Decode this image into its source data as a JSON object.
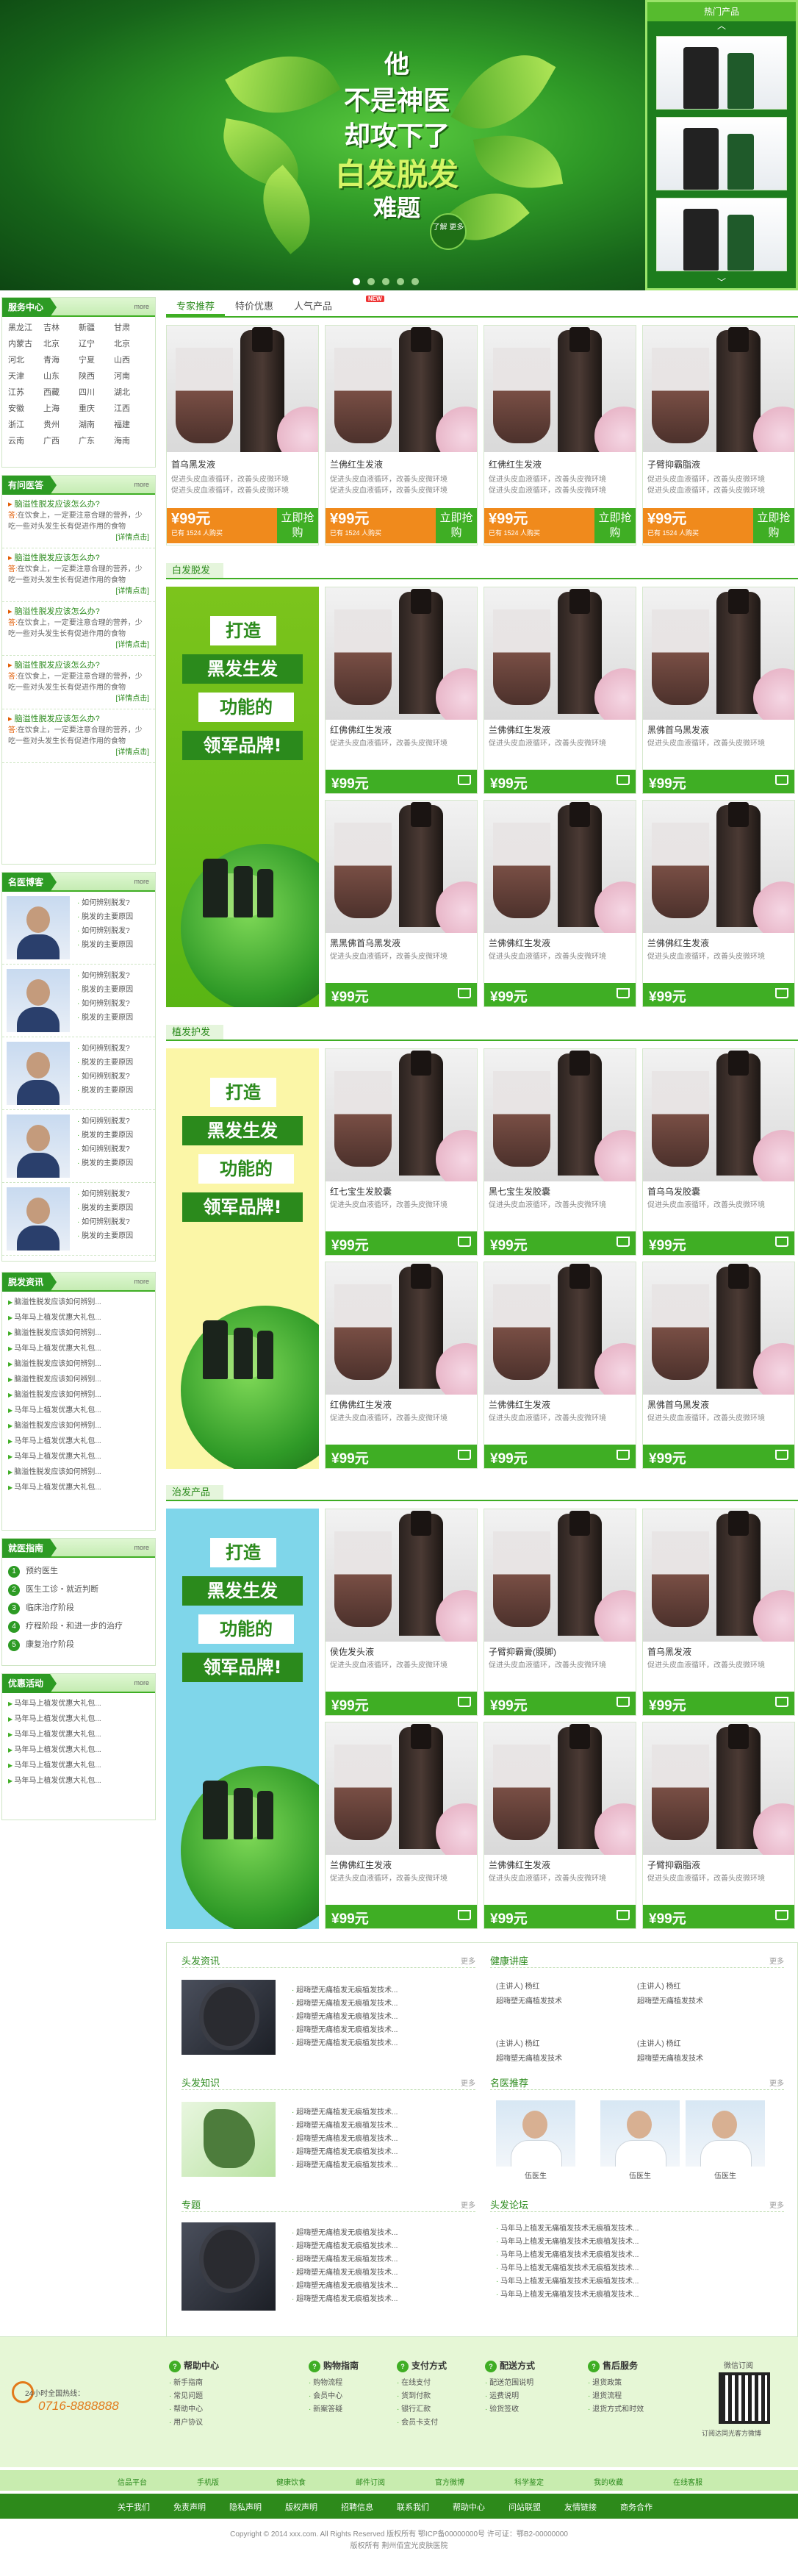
{
  "banner": {
    "l1": "他",
    "l2": "不是神医",
    "l3": "却攻下了",
    "l4": "白发脱发",
    "l5": "难题",
    "know": "了解\n更多",
    "hot_title": "热门产品"
  },
  "left": {
    "service": {
      "title": "服务中心",
      "more": "more",
      "regions": [
        "黑龙江",
        "吉林",
        "新疆",
        "甘肃",
        "内蒙古",
        "北京",
        "辽宁",
        "北京",
        "河北",
        "青海",
        "宁夏",
        "山西",
        "天津",
        "山东",
        "陕西",
        "河南",
        "江苏",
        "西藏",
        "四川",
        "湖北",
        "安徽",
        "上海",
        "重庆",
        "江西",
        "浙江",
        "贵州",
        "湖南",
        "福建",
        "云南",
        "广西",
        "广东",
        "海南"
      ]
    },
    "qa": {
      "title": "有问医答",
      "more": "more",
      "q": "脑溢性脱发应该怎么办?",
      "a_label": "答:",
      "a": "在饮食上，一定要注意合理的营养，少吃一些对头发生长有促进作用的食物",
      "detail": "[详情点击]"
    },
    "docs": {
      "title": "名医博客",
      "more": "more",
      "lines": [
        "如何辨别脱发?",
        "脱发的主要原因",
        "如何辨别脱发?",
        "脱发的主要原因"
      ]
    },
    "news": {
      "title": "脱发资讯",
      "more": "more",
      "items": [
        "脑溢性脱发应该如何辨别...",
        "马年马上植发优惠大礼包...",
        "脑溢性脱发应该如何辨别...",
        "马年马上植发优惠大礼包...",
        "脑溢性脱发应该如何辨别...",
        "脑溢性脱发应该如何辨别...",
        "脑溢性脱发应该如何辨别...",
        "马年马上植发优惠大礼包...",
        "脑溢性脱发应该如何辨别...",
        "马年马上植发优惠大礼包...",
        "马年马上植发优惠大礼包...",
        "脑溢性脱发应该如何辨别...",
        "马年马上植发优惠大礼包..."
      ]
    },
    "guide": {
      "title": "就医指南",
      "more": "more",
      "items": [
        "预约医生",
        "医生工诊・就近判断",
        "临床治疗阶段",
        "疗程阶段・和进一步的治疗",
        "康复治疗阶段"
      ]
    },
    "promo": {
      "title": "优惠活动",
      "more": "more",
      "items": [
        "马年马上植发优惠大礼包...",
        "马年马上植发优惠大礼包...",
        "马年马上植发优惠大礼包...",
        "马年马上植发优惠大礼包...",
        "马年马上植发优惠大礼包...",
        "马年马上植发优惠大礼包..."
      ]
    }
  },
  "tabs": [
    "专家推荐",
    "特价优惠",
    "人气产品"
  ],
  "tab_new": "NEW",
  "featured": [
    {
      "title": "首乌黑发液",
      "desc": "促进头皮血液循环，改善头皮微环境",
      "desc2": "促进头皮血液循环，改善头皮微环境",
      "price": "¥99元",
      "sold": "已有 1524 人购买",
      "go": "立即抢购"
    },
    {
      "title": "兰佛红生发液",
      "desc": "促进头皮血液循环，改善头皮微环境",
      "desc2": "促进头皮血液循环，改善头皮微环境",
      "price": "¥99元",
      "sold": "已有 1524 人购买",
      "go": "立即抢购"
    },
    {
      "title": "红佛红生发液",
      "desc": "促进头皮血液循环，改善头皮微环境",
      "desc2": "促进头皮血液循环，改善头皮微环境",
      "price": "¥99元",
      "sold": "已有 1524 人购买",
      "go": "立即抢购"
    },
    {
      "title": "子臂抑霸脂液",
      "desc": "促进头皮血液循环，改善头皮微环境",
      "desc2": "促进头皮血液循环，改善头皮微环境",
      "price": "¥99元",
      "sold": "已有 1524 人购买",
      "go": "立即抢购"
    }
  ],
  "promo_text": {
    "a": "打造",
    "b": "黑发生发",
    "c": "功能的",
    "d": "领军品牌!"
  },
  "sections": [
    {
      "title": "白发脱发",
      "items": [
        "红佛佛红生发液",
        "兰佛佛红生发液",
        "黑佛首乌黑发液",
        "黑黑佛首乌黑发液",
        "兰佛佛红生发液",
        "兰佛佛红生发液"
      ]
    },
    {
      "title": "植发护发",
      "items": [
        "红七宝生发胶囊",
        "黑七宝生发胶囊",
        "首乌乌发胶囊",
        "红佛佛红生发液",
        "兰佛佛红生发液",
        "黑佛首乌黑发液"
      ]
    },
    {
      "title": "治发产品",
      "items": [
        "侯佐发头液",
        "子臂抑霸膏(膜脚)",
        "首乌黑发液",
        "兰佛佛红生发液",
        "兰佛佛红生发液",
        "子臂抑霸脂液"
      ]
    }
  ],
  "card_desc": "促进头皮血液循环，改善头皮微环境",
  "card_price": "¥99元",
  "info": {
    "b1": {
      "title": "头发资讯",
      "more": "更多"
    },
    "b2": {
      "title": "健康讲座",
      "more": "更多"
    },
    "b3": {
      "title": "头发知识",
      "more": "更多"
    },
    "b4": {
      "title": "名医推荐",
      "more": "更多"
    },
    "b5": {
      "title": "专题",
      "more": "更多"
    },
    "b6": {
      "title": "头发论坛",
      "more": "更多"
    },
    "line": "超嗨塑无痛植发无痕植发技术...",
    "lecture": [
      "(主讲人) 杨红",
      "超嗨塑无痛植发技术",
      "(主讲人) 杨红",
      "超嗨塑无痛植发技术"
    ],
    "doctor": "伍医生",
    "forum": "马年马上植发无痛植发技术无痕植发技术..."
  },
  "footer": {
    "hotline_label": "24小时全国热线：",
    "hotline": "0716-8888888",
    "cols": [
      {
        "h": "帮助中心",
        "items": [
          "新手指南",
          "常见问题",
          "帮助中心",
          "用户协议"
        ]
      },
      {
        "h": "购物指南",
        "items": [
          "购物流程",
          "会员中心",
          "新案答疑"
        ]
      },
      {
        "h": "支付方式",
        "items": [
          "在线支付",
          "货到付款",
          "银行汇款",
          "会员卡支付"
        ]
      },
      {
        "h": "配送方式",
        "items": [
          "配送范围说明",
          "运费说明",
          "验货签收"
        ]
      },
      {
        "h": "售后服务",
        "items": [
          "退货政策",
          "退货流程",
          "退货方式和时效"
        ]
      }
    ],
    "qr_title": "微信订阅",
    "qr_sub": "订阅达同光客方微博",
    "badges": [
      "信品平台",
      "手机版",
      "健康饮食",
      "邮件订阅",
      "官方微博",
      "科学鉴定",
      "我的收藏",
      "在线客服"
    ],
    "nav": [
      "关于我们",
      "免责声明",
      "隐私声明",
      "版权声明",
      "招聘信息",
      "联系我们",
      "帮助中心",
      "问站联盟",
      "友情链接",
      "商务合作"
    ],
    "copy1": "Copyright © 2014 xxx.com. All Rights Reserved  版权所有 鄂ICP备00000000号  许可证：鄂B2-00000000",
    "copy2": "版权所有  荆州佰宜光皮肤医院"
  }
}
